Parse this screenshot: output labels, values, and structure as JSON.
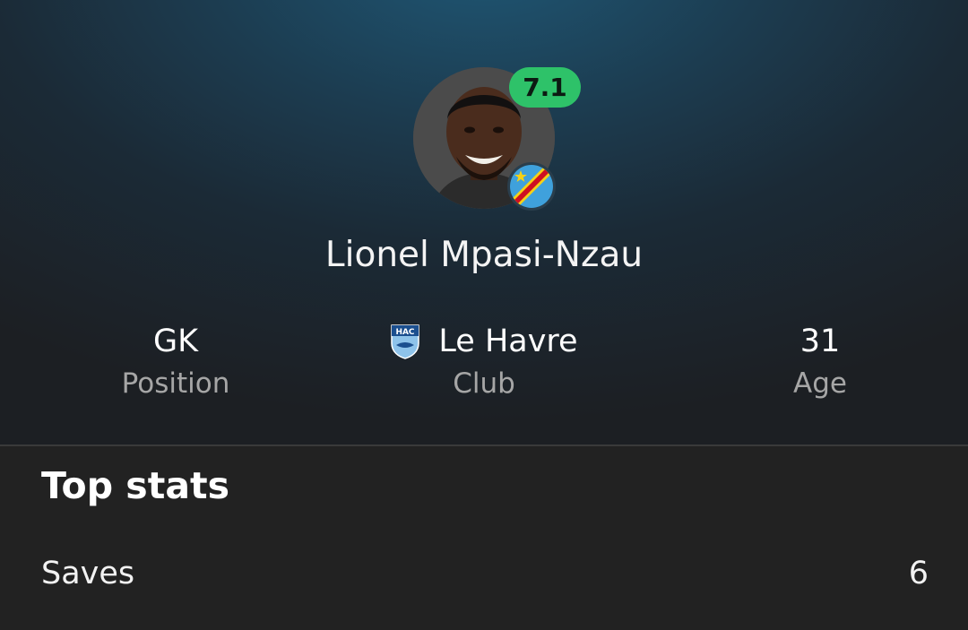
{
  "player": {
    "name": "Lionel Mpasi-Nzau",
    "rating": "7.1",
    "rating_color": "#2ec269",
    "nationality_flag_icon": "dr-congo-flag-icon"
  },
  "info": {
    "position": {
      "value": "GK",
      "label": "Position"
    },
    "club": {
      "value": "Le Havre",
      "label": "Club",
      "badge_icon": "le-havre-badge-icon",
      "badge_text": "HAC"
    },
    "age": {
      "value": "31",
      "label": "Age"
    }
  },
  "top_stats": {
    "title": "Top stats",
    "rows": [
      {
        "label": "Saves",
        "value": "6"
      }
    ]
  }
}
